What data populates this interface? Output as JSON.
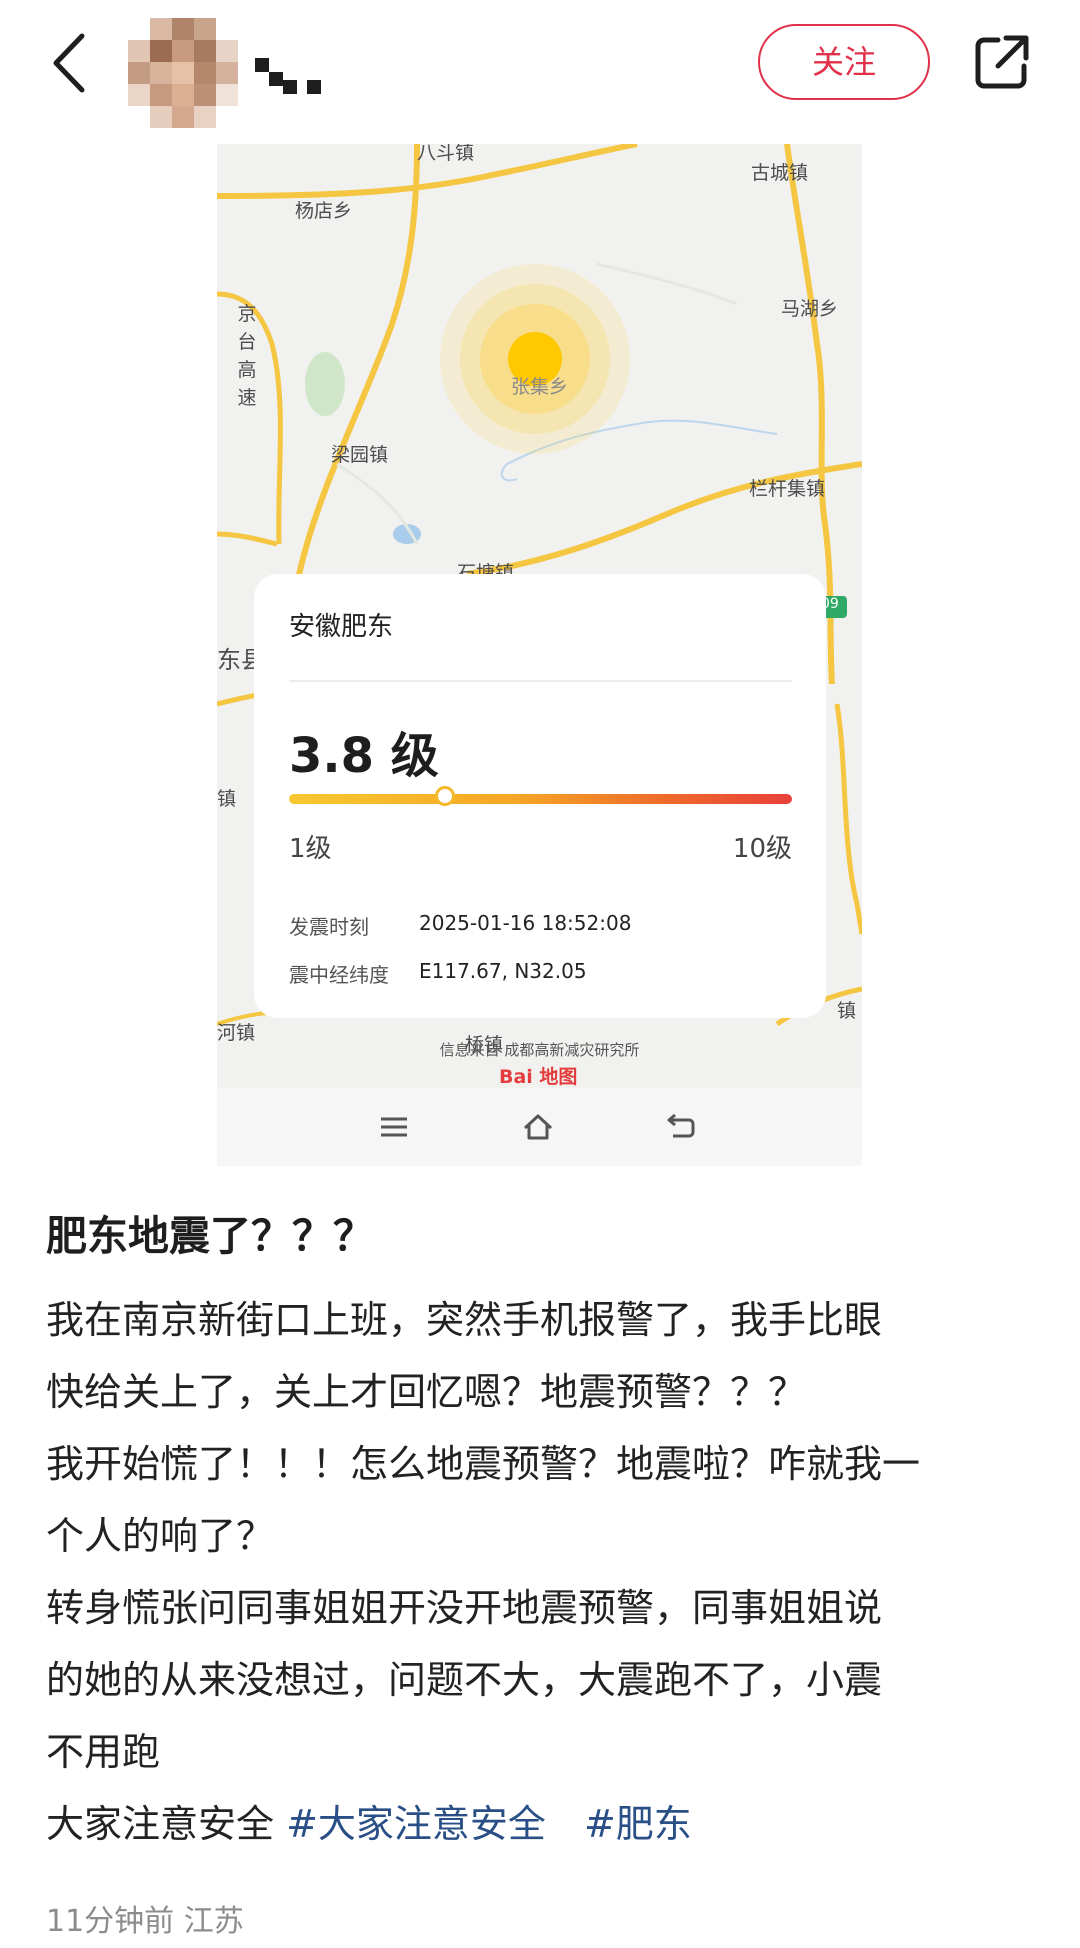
{
  "header": {
    "follow_label": "关注"
  },
  "screenshot": {
    "map_labels": {
      "top": "八斗镇",
      "gucheng": "古城镇",
      "yangdian": "杨店乡",
      "mahu": "马湖乡",
      "jingtai": "京台高速",
      "zhangji": "张集乡",
      "liangyuan": "梁园镇",
      "langan": "栏杆集镇",
      "shitang": "石塘镇",
      "dongxian": "东县",
      "zhenleft": "镇",
      "hezhen": "河镇",
      "qiao": "桥镇",
      "right_zhen": "镇",
      "road_badge": "09"
    },
    "card": {
      "location": "安徽肥东",
      "magnitude": "3.8 级",
      "magnitude_value": 3.8,
      "scale_min_label": "1级",
      "scale_max_label": "10级",
      "scale_min": 1,
      "scale_max": 10,
      "time_label": "发震时刻",
      "time_value": "2025-01-16 18:52:08",
      "coord_label": "震中经纬度",
      "coord_value": "E117.67, N32.05"
    },
    "source": "信息来自 成都高新减灾研究所",
    "baidu_logo": "Bai 地图",
    "nav_icons": [
      "menu-icon",
      "home-icon",
      "back-arrow-icon"
    ]
  },
  "post": {
    "title": "肥东地震了？？？",
    "lines": [
      "我在南京新街口上班，突然手机报警了，我手比眼",
      "快给关上了，关上才回忆嗯？地震预警？？？",
      "我开始慌了！！！怎么地震预警？地震啦？咋就我一",
      "个人的响了？",
      "转身慌张问同事姐姐开没开地震预警，同事姐姐说",
      "的她的从来没想过，问题不大，大震跑不了，小震",
      "不用跑"
    ],
    "last_line_text": "大家注意安全 ",
    "hashtag_1": "#大家注意安全",
    "hashtag_2": "#肥东",
    "meta": "11分钟前 江苏"
  },
  "colors": {
    "accent": "#e0304a",
    "hashtag": "#2a4f86",
    "road": "#f5c642",
    "quake": "#ffc800"
  }
}
